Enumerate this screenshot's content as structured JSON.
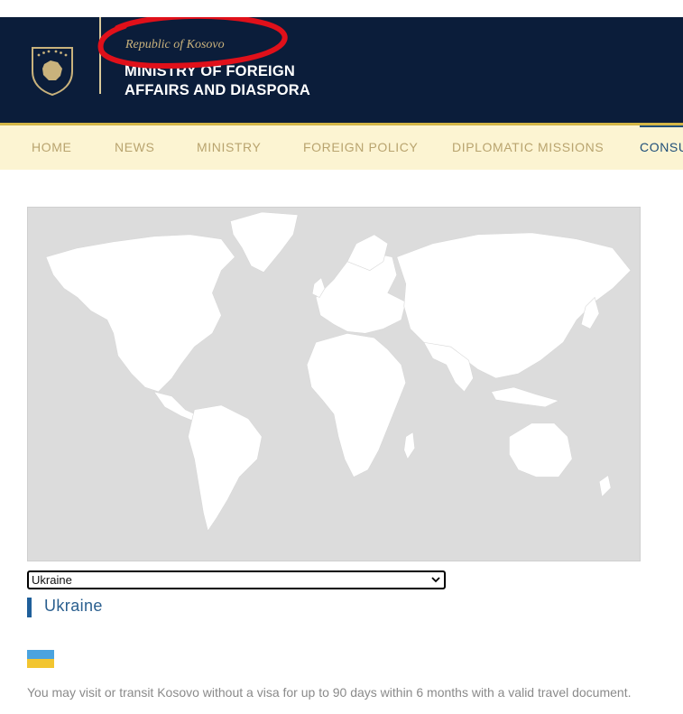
{
  "header": {
    "republic": "Republic of Kosovo",
    "ministry_line1": "MINISTRY OF FOREIGN",
    "ministry_line2": "AFFAIRS AND DIASPORA"
  },
  "nav": {
    "items": [
      {
        "label": "HOME"
      },
      {
        "label": "NEWS"
      },
      {
        "label": "MINISTRY"
      },
      {
        "label": "FOREIGN POLICY"
      },
      {
        "label": "DIPLOMATIC MISSIONS"
      },
      {
        "label": "CONSU"
      }
    ],
    "active_index": 5
  },
  "country_select": {
    "selected": "Ukraine"
  },
  "country": {
    "name": "Ukraine",
    "info": "You may visit or transit Kosovo without a visa for up to 90 days within 6 months with a valid travel document."
  },
  "colors": {
    "header_bg": "#0b1d3a",
    "gold": "#d4b646",
    "nav_bg": "#fcf4d2",
    "nav_text": "#b9a46f",
    "nav_active": "#1f4e79",
    "accent_blue": "#1f5f9a",
    "annotation_red": "#e0101a",
    "flag_blue": "#4aa3df",
    "flag_yellow": "#f2c530"
  },
  "icons": {
    "emblem": "kosovo-emblem-icon",
    "select_chevron": "chevron-down-icon",
    "flag": "ukraine-flag-icon"
  }
}
